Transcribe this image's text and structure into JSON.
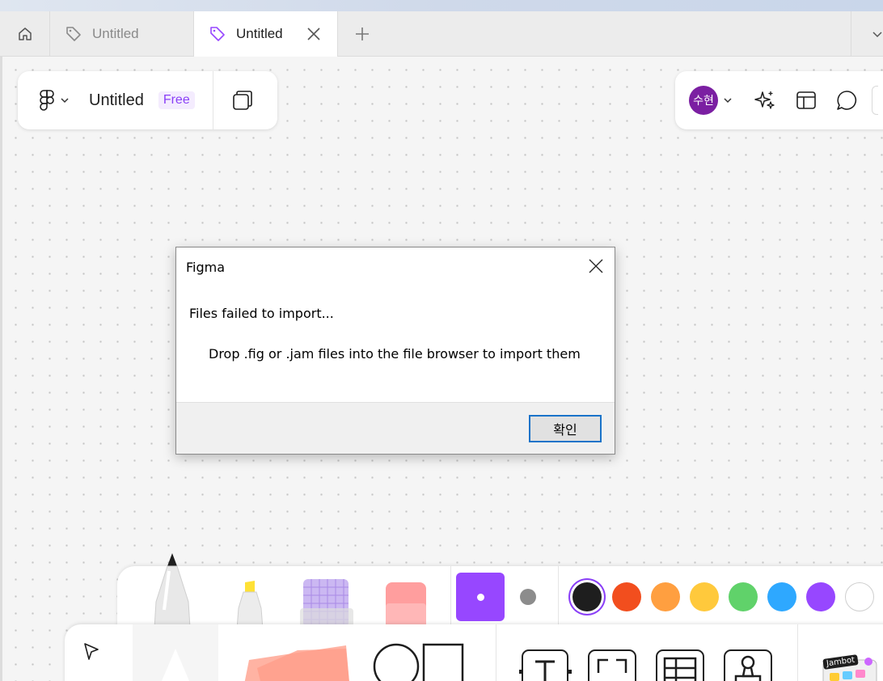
{
  "tabs": [
    {
      "label": "Untitled",
      "active": false
    },
    {
      "label": "Untitled",
      "active": true
    }
  ],
  "file": {
    "title": "Untitled",
    "plan_badge": "Free"
  },
  "user": {
    "avatar_initials": "수현",
    "avatar_color": "#7b1fa2"
  },
  "dialog": {
    "title": "Figma",
    "message": "Files failed to import...",
    "detail": "Drop .fig or .jam files into the file browser to import them",
    "ok_label": "확인"
  },
  "colors": {
    "accent": "#9747ff",
    "swatches": [
      "#1e1e1e",
      "#f24e1e",
      "#ff9f40",
      "#ffc93c",
      "#60d26a",
      "#2ea8ff",
      "#9747ff",
      "#ffffff"
    ]
  },
  "bottom_toolbar": {
    "sticker_label": "Jambot"
  }
}
